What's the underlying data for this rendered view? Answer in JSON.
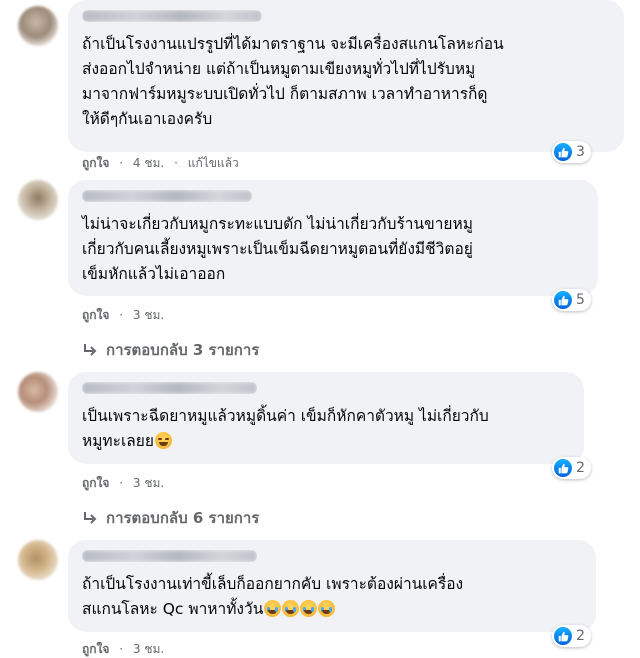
{
  "comments": [
    {
      "text": "ถ้าเป็นโรงงานแปรรูปที่ได้มาตราฐาน จะมีเครื่องสแกนโลหะก่อน\nส่งออกไปจำหน่าย แต่ถ้าเป็นหมูตามเขียงหมูทั่วไปที่ไปรับหมู\nมาจากฟาร์มหมูระบบเปิดทั่วไป ก็ตามสภาพ เวลาทำอาหารก็ดู\nให้ดีๆกันเอาเองครับ",
      "reactions": "3",
      "like_label": "ถูกใจ",
      "time": "4 ชม.",
      "edited": "แก้ไขแล้ว"
    },
    {
      "text": "ไม่น่าจะเกี่ยวกับหมูกระทะแบบตัก ไม่น่าเกี่ยวกับร้านขายหมู\nเกี่ยวกับคนเลี้ยงหมูเพราะเป็นเข็มฉีดยาหมูตอนที่ยังมีชีวิตอยู่\nเข็มหักแล้วไม่เอาออก",
      "reactions": "5",
      "like_label": "ถูกใจ",
      "time": "3 ชม.",
      "replies": "การตอบกลับ 3 รายการ"
    },
    {
      "text": "เป็นเพราะฉีดยาหมูแล้วหมูดิ้นค่า เข็มก็หักคาตัวหมู ไม่เกี่ยวกับ\nหมูทะเลยย",
      "reactions": "2",
      "like_label": "ถูกใจ",
      "time": "3 ชม.",
      "replies": "การตอบกลับ 6 รายการ"
    },
    {
      "text": "ถ้าเป็นโรงงานเท่าขี้เล็บก็ออกยากคับ เพราะต้องผ่านเครื่อง\nสแกนโลหะ Qc พาหาทั้งวัน",
      "reactions": "2",
      "like_label": "ถูกใจ",
      "time": "3 ชม."
    }
  ],
  "icons": {
    "like": "thumbs-up-icon",
    "reply_arrow": "reply-arrow-icon",
    "emoji_sad": "pleading-face-emoji",
    "emoji_laugh": "tears-of-joy-emoji"
  },
  "colors": {
    "bubble": "#f0f2f5",
    "meta": "#65676b",
    "like_blue": "#1877f2"
  }
}
